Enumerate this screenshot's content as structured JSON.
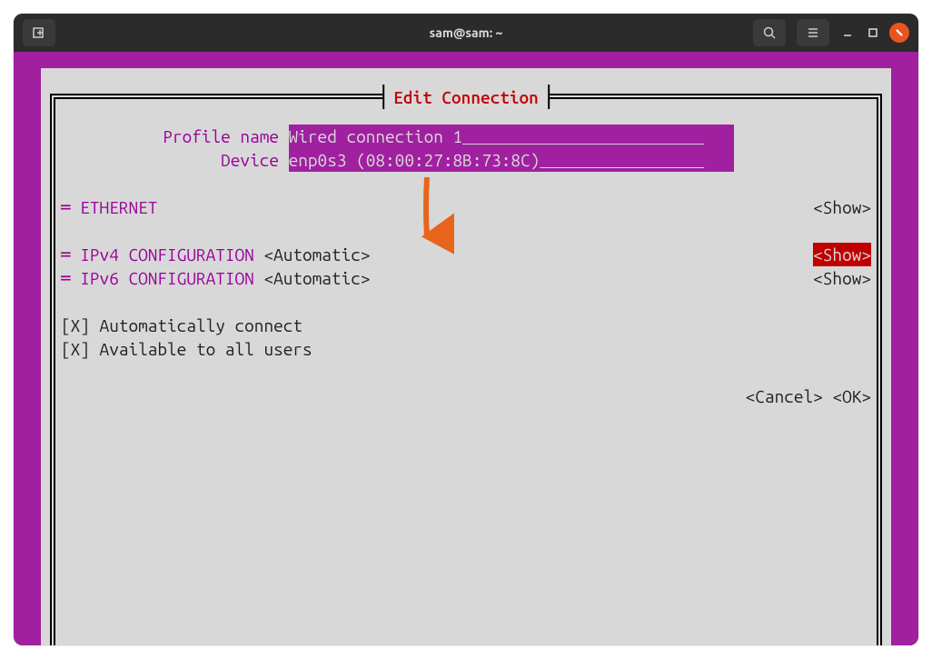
{
  "titlebar": {
    "title": "sam@sam: ~"
  },
  "panel": {
    "title": " Edit Connection "
  },
  "fields": {
    "profile_name_label": "Profile name",
    "profile_name_value": "Wired connection 1",
    "device_label": "Device",
    "device_value": "enp0s3 (08:00:27:8B:73:8C)"
  },
  "sections": {
    "ethernet_label": "ETHERNET",
    "ethernet_action": "<Show>",
    "ipv4_label": "IPv4 CONFIGURATION",
    "ipv4_mode": "<Automatic>",
    "ipv4_action": "<Show>",
    "ipv6_label": "IPv6 CONFIGURATION",
    "ipv6_mode": "<Automatic>",
    "ipv6_action": "<Show>"
  },
  "checks": {
    "auto_connect": "[X] Automatically connect",
    "all_users": "[X] Available to all users"
  },
  "buttons": {
    "cancel": "<Cancel>",
    "ok": "<OK>"
  }
}
